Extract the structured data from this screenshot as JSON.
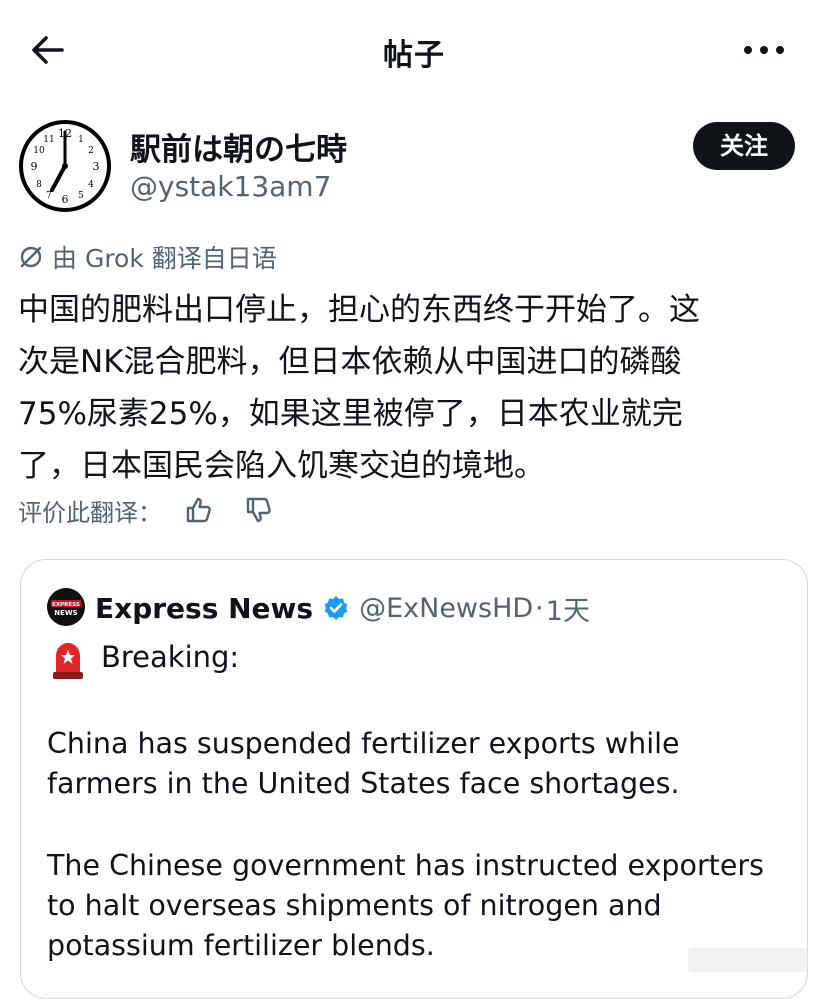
{
  "header": {
    "title": "帖子",
    "back_icon": "arrow-left-icon",
    "more_icon": "more-horizontal-icon"
  },
  "author": {
    "display_name": "駅前は朝の七時",
    "handle": "@ystak13am7",
    "follow_label": "关注",
    "avatar_icon": "wall-clock-icon"
  },
  "translation": {
    "note": "由 Grok 翻译自日语",
    "icon": "slashed-circle-icon"
  },
  "post": {
    "lines": [
      "中国的肥料出口停止，担心的东西终于开始了。这",
      "次是NK混合肥料，但日本依赖从中国进口的磷酸",
      "75%尿素25%，如果这里被停了，日本农业就完",
      "了，日本国民会陷入饥寒交迫的境地。"
    ]
  },
  "rating": {
    "label": "评价此翻译：",
    "like_icon": "thumbs-up-icon",
    "dislike_icon": "thumbs-down-icon"
  },
  "quote": {
    "name": "Express News",
    "verified_icon": "verified-badge-icon",
    "avatar_text": "EXPRESS NEWS",
    "handle": "@ExNewsHD",
    "dot": "·",
    "time": "1天",
    "breaking_icon": "siren-icon",
    "breaking": "Breaking:",
    "para1": [
      "China has suspended fertilizer exports while",
      "farmers in the United States face shortages."
    ],
    "para2": [
      "The Chinese government has instructed exporters",
      "to halt overseas shipments of nitrogen and",
      "potassium fertilizer blends."
    ]
  },
  "colors": {
    "text": "#0f1419",
    "secondary": "#536471",
    "border": "#cfd9de",
    "verified": "#1d9bf0",
    "button": "#0f1419"
  }
}
